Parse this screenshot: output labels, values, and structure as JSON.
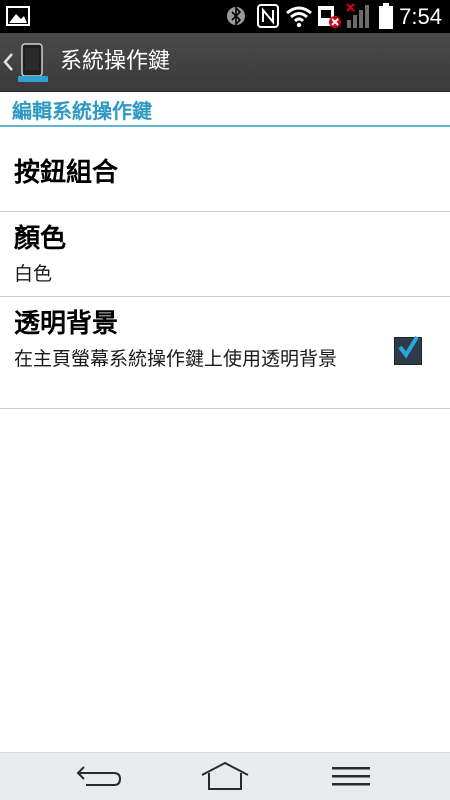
{
  "status_bar": {
    "time": "7:54",
    "icons": [
      "image-notification-icon",
      "bluetooth-icon",
      "nfc-icon",
      "wifi-icon",
      "sim-error-icon",
      "signal-icon",
      "battery-icon"
    ]
  },
  "action_bar": {
    "title": "系統操作鍵",
    "icons": [
      "back-chevron-icon",
      "phone-settings-icon"
    ]
  },
  "section": {
    "header": "編輯系統操作鍵"
  },
  "settings": {
    "items": [
      {
        "title": "按鈕組合",
        "summary": ""
      },
      {
        "title": "顏色",
        "summary": "白色"
      },
      {
        "title": "透明背景",
        "summary": "在主頁螢幕系統操作鍵上使用透明背景",
        "checked": true
      }
    ]
  },
  "nav_bar": {
    "icons": [
      "back-icon",
      "home-icon",
      "menu-icon"
    ]
  },
  "colors": {
    "accent": "#2e9ac4",
    "action_bar": "#404040",
    "nav_bar": "#e9ecef",
    "checkbox_check": "#29a8e0"
  }
}
